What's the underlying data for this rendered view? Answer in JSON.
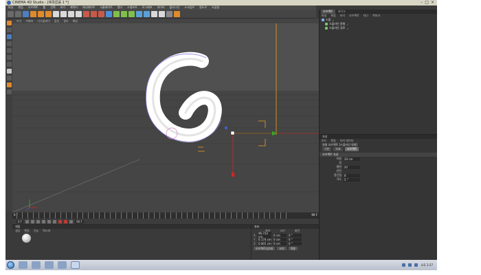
{
  "window": {
    "title": "CINEMA 4D Studio - [제목없음 1 *]"
  },
  "menu": [
    "파일",
    "편집",
    "오브젝트",
    "툴",
    "선택",
    "보기",
    "캐릭터",
    "애니메이트",
    "시뮬레이트",
    "렌더",
    "스컬프트",
    "모그래프",
    "하이어",
    "플러그인",
    "스크립트",
    "윈도우",
    "도움말"
  ],
  "viewport": {
    "menu": [
      "보기",
      "카메라",
      "디스플레이",
      "옵션",
      "필터",
      "패널"
    ],
    "label": "원근 뷰"
  },
  "timeline": {
    "start": "0 F",
    "end": "90 F",
    "current_frame": "0 F"
  },
  "material_panel": {
    "tab": "재질",
    "menu": [
      "생성",
      "편집",
      "기능",
      "텍스쳐"
    ]
  },
  "coords_panel": {
    "tab": "좌표",
    "headers": [
      "위치",
      "크기",
      "회전"
    ],
    "rows": [
      {
        "axis": "X",
        "pos": "96.732 cm",
        "size": "0 cm",
        "rot": "0 °"
      },
      {
        "axis": "Y",
        "pos": "0.174 cm",
        "size": "0 cm",
        "rot": "0 °"
      },
      {
        "axis": "Z",
        "pos": "0.001 cm",
        "size": "0 cm",
        "rot": "0 °"
      }
    ],
    "buttons": [
      "오브젝트(상대)",
      "크기",
      "적용"
    ]
  },
  "object_panel": {
    "tabs": [
      "오브젝트",
      "테이크"
    ],
    "menu": [
      "파일",
      "편집",
      "보기",
      "오브젝트",
      "태그",
      "북마크"
    ],
    "items": [
      {
        "name": "스윕"
      },
      {
        "name": "스플라인 원형"
      },
      {
        "name": "스플라인 경로"
      }
    ]
  },
  "attribute_panel": {
    "tab": "속성",
    "menu": [
      "모드",
      "편집",
      "유저 데이터"
    ],
    "object_label": "원형 오브젝트 [스플라인 원형]",
    "tabs": [
      "기본",
      "좌표",
      "오브젝트"
    ],
    "section": "오브젝트 속성",
    "fields": [
      {
        "label": "타원",
        "value": "20 cm"
      },
      {
        "label": "링",
        "value": ""
      },
      {
        "label": "평면",
        "value": "XY"
      },
      {
        "label": "반전",
        "value": ""
      },
      {
        "label": "중간점",
        "value": "8"
      },
      {
        "label": "각도",
        "value": "5 °"
      }
    ]
  },
  "taskbar": {
    "time": "오후 2:27"
  },
  "colors": {
    "accent": "#f0a020",
    "x_axis": "#e02020",
    "y_axis": "#20c020",
    "z_axis": "#2060e0"
  }
}
